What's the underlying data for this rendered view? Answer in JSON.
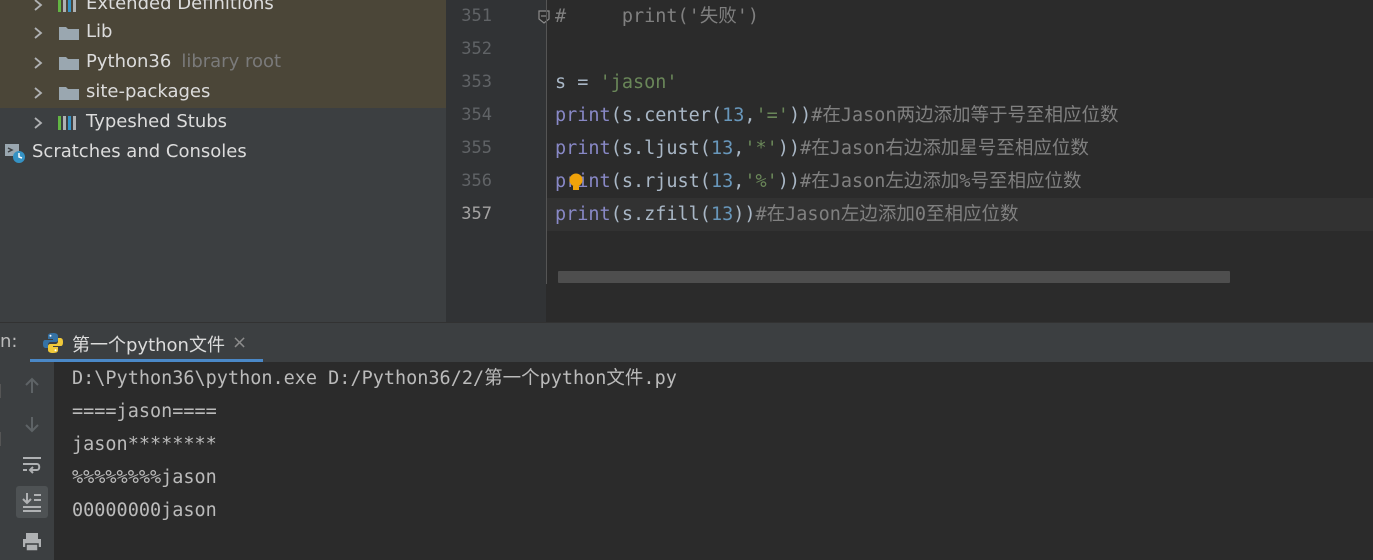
{
  "project_tree": {
    "items": [
      {
        "label": "Extended Definitions",
        "icon": "library-icon"
      },
      {
        "label": "Lib",
        "icon": "folder-icon"
      },
      {
        "label": "Python36",
        "suffix": "library root",
        "icon": "folder-icon"
      },
      {
        "label": "site-packages",
        "icon": "folder-icon"
      },
      {
        "label": "Typeshed Stubs",
        "icon": "library-icon"
      }
    ],
    "scratches": "Scratches and Consoles"
  },
  "editor": {
    "line_numbers": [
      "351",
      "352",
      "353",
      "354",
      "355",
      "356",
      "357"
    ],
    "current_line": "357",
    "lines": [
      [
        {
          "t": "#     print('失败')",
          "c": "cmt"
        }
      ],
      [],
      [
        {
          "t": "s = ",
          "c": ""
        },
        {
          "t": "'jason'",
          "c": "str"
        }
      ],
      [
        {
          "t": "print",
          "c": "kw-fn"
        },
        {
          "t": "(s.center(",
          "c": ""
        },
        {
          "t": "13",
          "c": "num"
        },
        {
          "t": ",",
          "c": ""
        },
        {
          "t": "'='",
          "c": "str"
        },
        {
          "t": "))",
          "c": ""
        },
        {
          "t": "#在Jason两边添加等于号至相应位数",
          "c": "cmt"
        }
      ],
      [
        {
          "t": "print",
          "c": "kw-fn"
        },
        {
          "t": "(s.ljust(",
          "c": ""
        },
        {
          "t": "13",
          "c": "num"
        },
        {
          "t": ",",
          "c": ""
        },
        {
          "t": "'*'",
          "c": "str"
        },
        {
          "t": "))",
          "c": ""
        },
        {
          "t": "#在Jason右边添加星号至相应位数",
          "c": "cmt"
        }
      ],
      [
        {
          "t": "print",
          "c": "kw-fn"
        },
        {
          "t": "(s.rjust(",
          "c": ""
        },
        {
          "t": "13",
          "c": "num"
        },
        {
          "t": ",",
          "c": ""
        },
        {
          "t": "'%'",
          "c": "str"
        },
        {
          "t": "))",
          "c": ""
        },
        {
          "t": "#在Jason左边添加%号至相应位数",
          "c": "cmt"
        }
      ],
      [
        {
          "t": "print",
          "c": "kw-fn"
        },
        {
          "t": "(s.zfill(",
          "c": ""
        },
        {
          "t": "13",
          "c": "num"
        },
        {
          "t": "))",
          "c": ""
        },
        {
          "t": "#在Jason左边添加0至相应位数",
          "c": "cmt"
        }
      ]
    ]
  },
  "run": {
    "label": "n:",
    "tab_title": "第一个python文件",
    "close_glyph": "×",
    "output": [
      "D:\\Python36\\python.exe D:/Python36/2/第一个python文件.py",
      "====jason====",
      "jason********",
      "%%%%%%%%jason",
      "00000000jason"
    ]
  },
  "colors": {
    "background": "#2b2b2b",
    "panel": "#3c3f41",
    "highlight_row": "#4b4638",
    "accent": "#4a88c7",
    "string": "#6a8759",
    "number": "#6897bb",
    "builtin": "#8888c6",
    "comment": "#808080"
  }
}
